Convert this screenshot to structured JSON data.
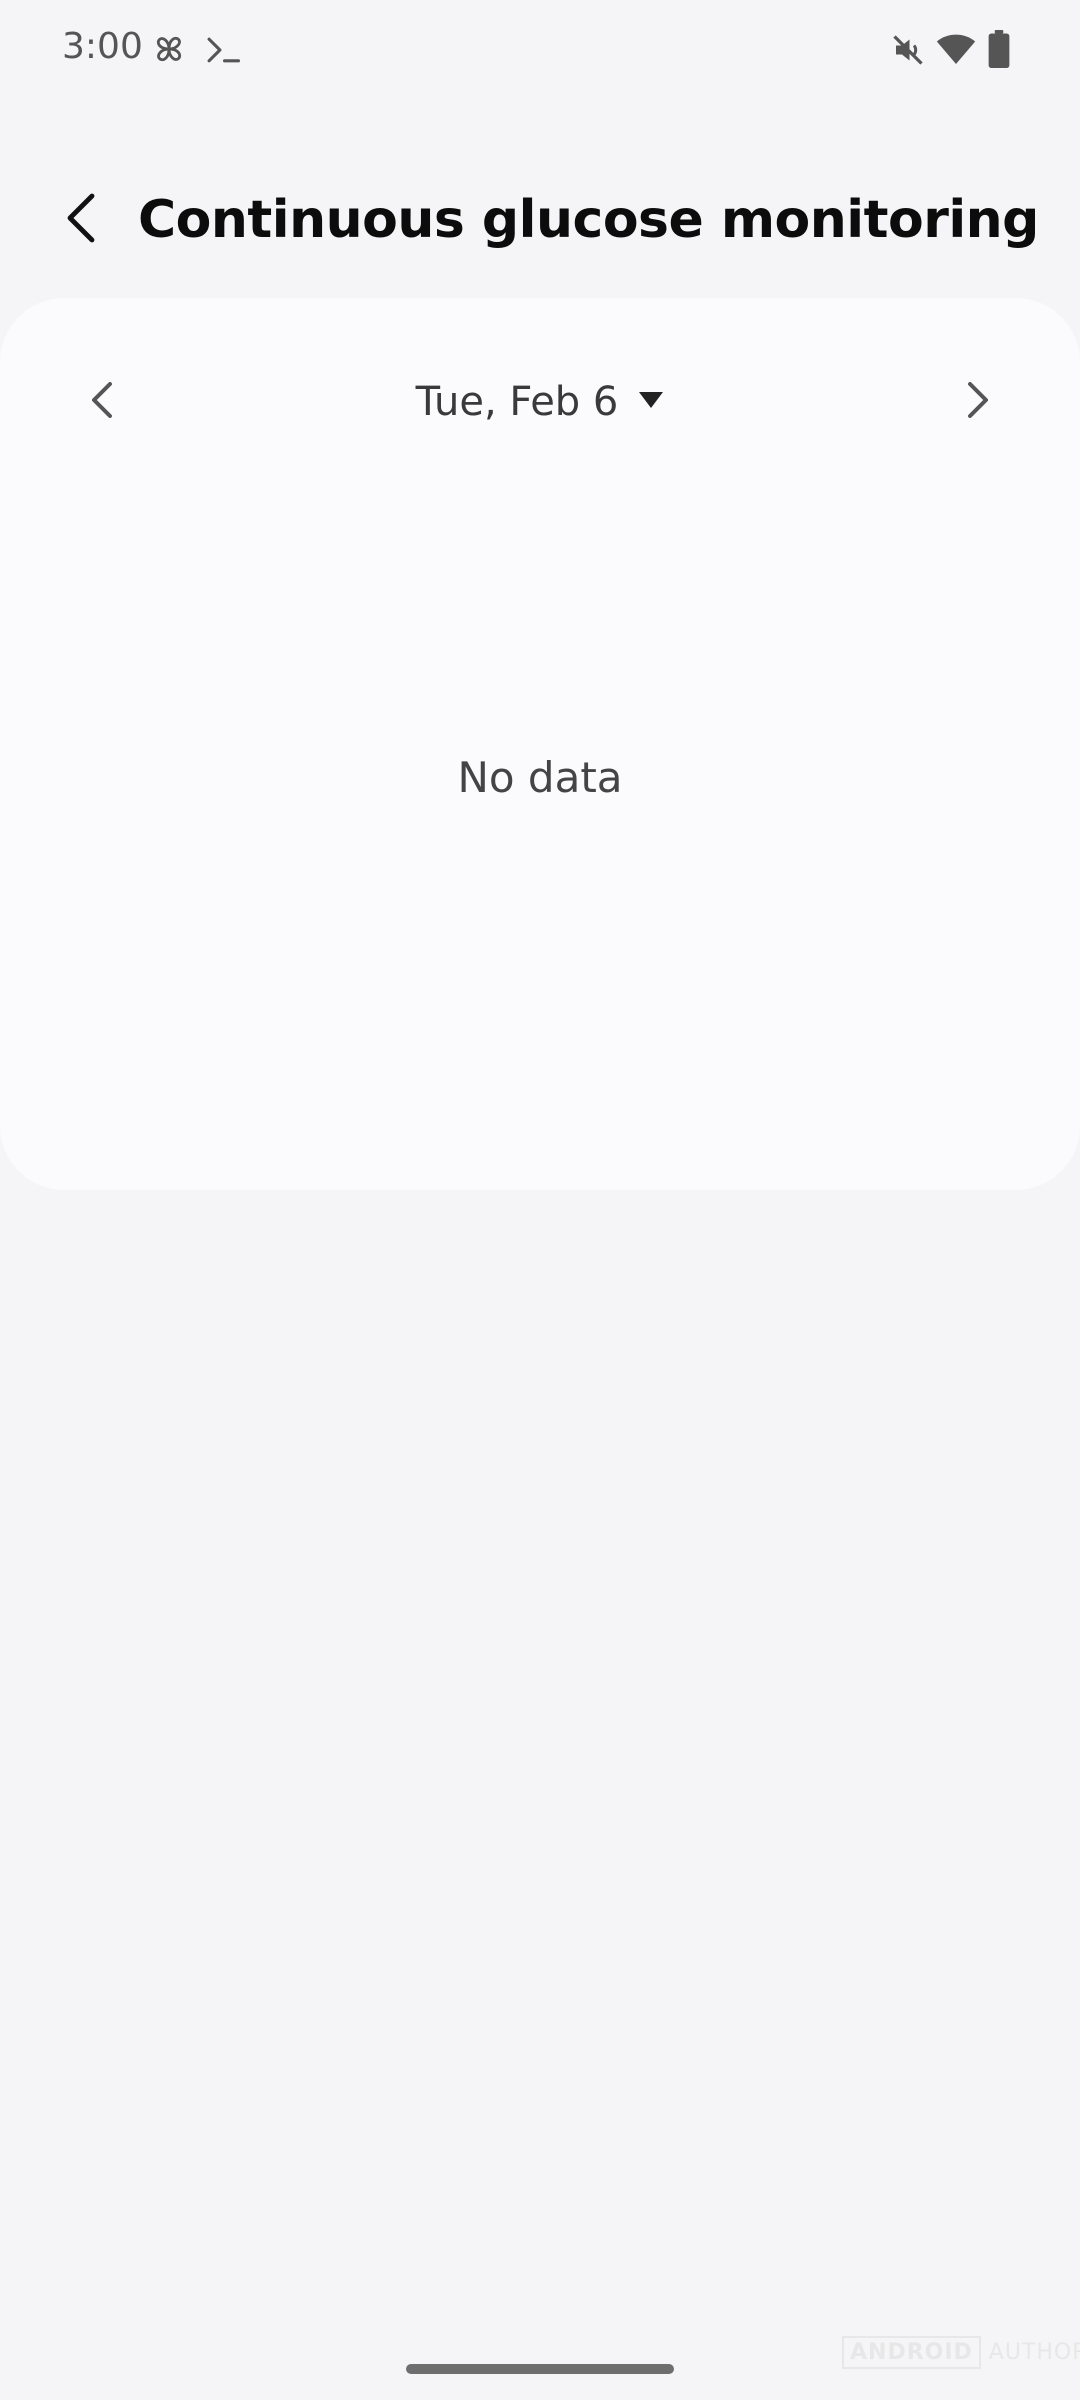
{
  "status_bar": {
    "time": "3:00",
    "icons": [
      "pinwheel-icon",
      "terminal-icon",
      "mute-icon",
      "wifi-icon",
      "battery-icon"
    ]
  },
  "header": {
    "title": "Continuous glucose monitoring",
    "back_icon": "back-arrow-icon"
  },
  "date_nav": {
    "date": "Tue, Feb 6",
    "prev_icon": "chevron-left-icon",
    "next_icon": "chevron-right-icon",
    "dropdown_icon": "triangle-down-icon"
  },
  "card": {
    "empty_message": "No data"
  },
  "watermark": {
    "brand": "ANDROID",
    "brand_suffix": "AUTHORITY"
  },
  "colors": {
    "background": "#f5f5f7",
    "card": "#fbfbfe",
    "title_text": "#0c0c0c",
    "secondary_text": "#3a3a3a"
  }
}
